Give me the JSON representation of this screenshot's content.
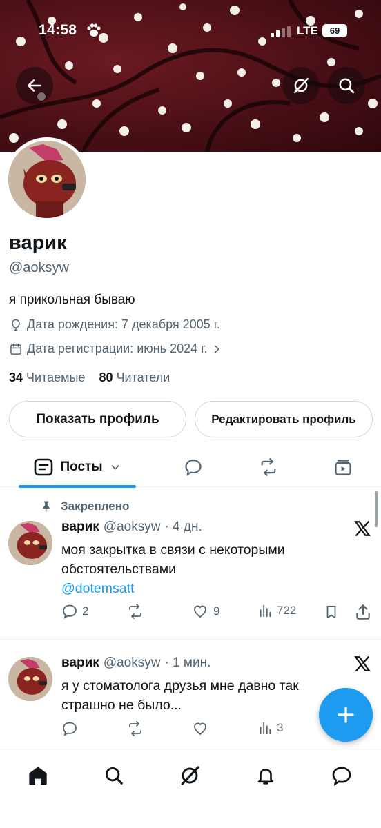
{
  "status_bar": {
    "time": "14:58",
    "network": "LTE",
    "battery": "69"
  },
  "profile": {
    "name": "варик",
    "handle": "@aoksyw",
    "bio": "я прикольная бываю",
    "birthday": "Дата рождения: 7 декабря 2005 г.",
    "joined": "Дата регистрации: июнь 2024 г.",
    "following_count": "34",
    "following_label": "Читаемые",
    "followers_count": "80",
    "followers_label": "Читатели"
  },
  "buttons": {
    "show_profile": "Показать профиль",
    "edit_profile": "Редактировать профиль"
  },
  "tabs": {
    "posts": "Посты"
  },
  "posts": [
    {
      "pinned_label": "Закреплено",
      "name": "варик",
      "handle": "@aoksyw",
      "time": "· 4 дн.",
      "text_line1": "моя закрытка в связи с некоторыми",
      "text_line2": "обстоятельствами",
      "mention": "@dotemsatt",
      "replies": "2",
      "reposts": "",
      "likes": "9",
      "views": "722"
    },
    {
      "name": "варик",
      "handle": "@aoksyw",
      "time": "· 1 мин.",
      "text_line1": "я у стоматолога друзья мне давно так",
      "text_line2": "страшно не было...",
      "replies": "",
      "reposts": "",
      "likes": "",
      "views": "3"
    }
  ],
  "colors": {
    "accent": "#1d9bf0",
    "text": "#0f1419",
    "secondary": "#536471",
    "banner": "#5a1219"
  }
}
